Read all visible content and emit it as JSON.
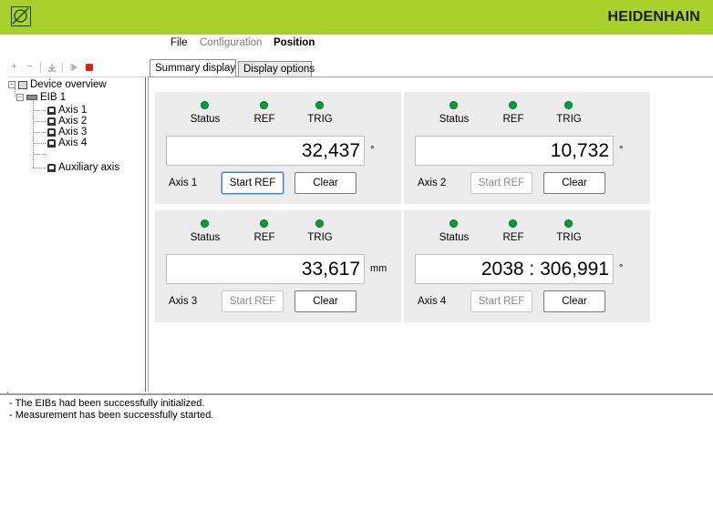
{
  "header": {
    "brand": "HEIDENHAIN",
    "logo_icon": "app-logo-icon",
    "color": "#a9d12b"
  },
  "menu": {
    "items": [
      "File",
      "Configuration",
      "Position"
    ],
    "active": "Position"
  },
  "toolbar": {
    "icons": [
      "add-icon",
      "remove-icon",
      "download-icon",
      "play-icon",
      "stop-icon"
    ]
  },
  "tree": {
    "root": "Device overview",
    "device": "EIB 1",
    "axes": [
      "Axis 1",
      "Axis 2",
      "Axis 3",
      "Axis 4",
      "Auxiliary axis"
    ]
  },
  "tabs": [
    "Summary display",
    "Display options"
  ],
  "active_tab": "Summary display",
  "indicators": {
    "status": "Status",
    "ref": "REF",
    "trig": "TRIG",
    "led_color": "#0b9a3a"
  },
  "axes": [
    {
      "name": "Axis 1",
      "value": "32,437",
      "unit": "°",
      "start_ref": "Start REF",
      "clear": "Clear",
      "start_ref_enabled": true
    },
    {
      "name": "Axis 2",
      "value": "10,732",
      "unit": "°",
      "start_ref": "Start REF",
      "clear": "Clear",
      "start_ref_enabled": false
    },
    {
      "name": "Axis 3",
      "value": "33,617",
      "unit": "mm",
      "start_ref": "Start REF",
      "clear": "Clear",
      "start_ref_enabled": false
    },
    {
      "name": "Axis 4",
      "value": "2038 : 306,991",
      "unit": "°",
      "start_ref": "Start REF",
      "clear": "Clear",
      "start_ref_enabled": false
    }
  ],
  "log": [
    "- The EIBs had been successfully initialized.",
    "- Measurement has been successfully started."
  ]
}
